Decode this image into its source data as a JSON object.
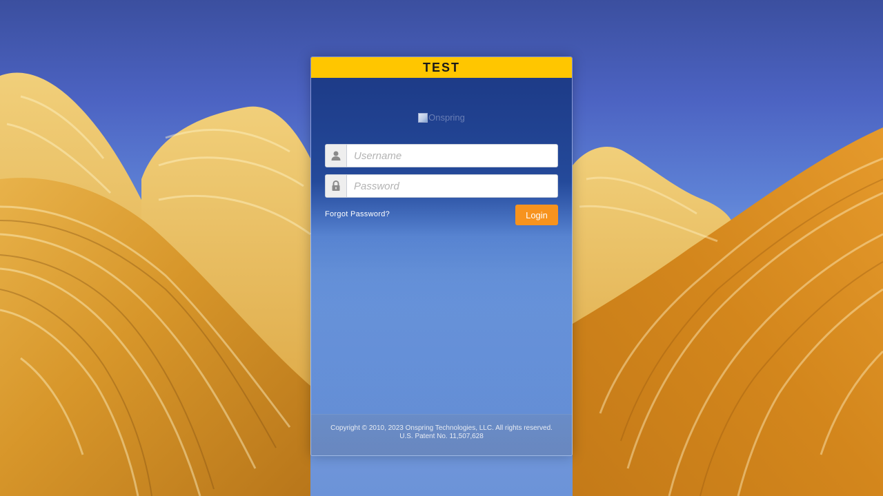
{
  "environment_label": "TEST",
  "logo": {
    "alt_text": "Onspring"
  },
  "login_form": {
    "username_placeholder": "Username",
    "password_placeholder": "Password",
    "forgot_password_label": "Forgot Password?",
    "login_button_label": "Login"
  },
  "footer": {
    "copyright": "Copyright © 2010, 2023 Onspring Technologies, LLC. All rights reserved.",
    "patent": "U.S. Patent No. 11,507,628"
  },
  "icons": {
    "username": "user-icon",
    "password": "lock-icon"
  },
  "colors": {
    "header_banner": "#ffc600",
    "login_button": "#f7931e",
    "panel": "#1c3a86"
  }
}
